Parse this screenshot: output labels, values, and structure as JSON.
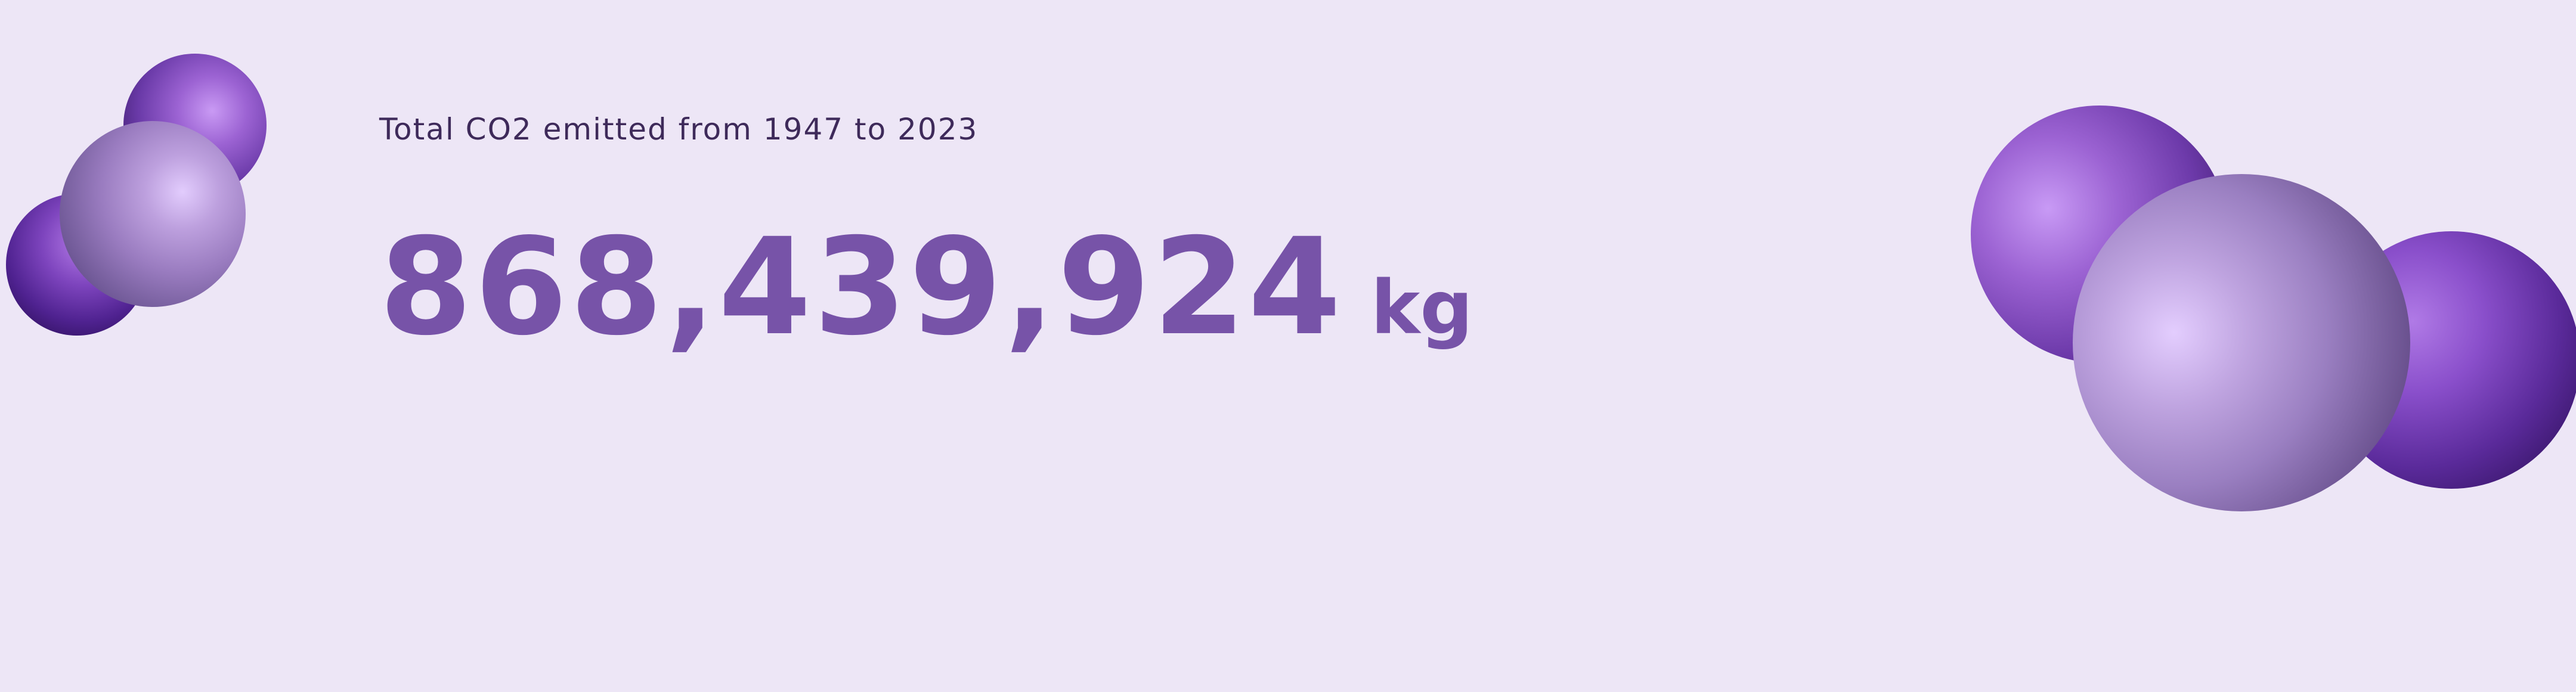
{
  "headline": {
    "subtitle": "Total CO2 emitted from 1947 to 2023",
    "value": "868,439,924",
    "unit": "kg"
  },
  "colors": {
    "background": "#ede6f6",
    "number": "#7753a8",
    "subtitle": "#3e2a5a",
    "sphere_dark": "#2a0f52",
    "sphere_light": "#e2ccfd"
  },
  "decorations": {
    "left_cluster": "co2-molecule-icon",
    "right_cluster": "co2-molecule-icon"
  }
}
